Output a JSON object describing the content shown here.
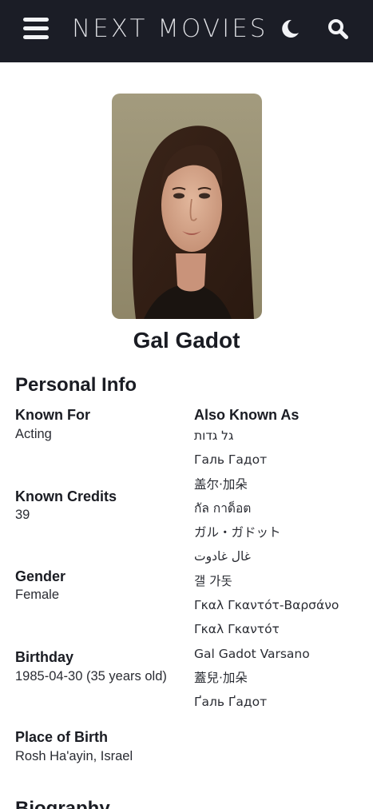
{
  "header": {
    "brand": "NEXT MOVIES",
    "menu_icon": "hamburger-menu-icon",
    "theme_icon": "moon-icon",
    "search_icon": "search-icon",
    "background": "#1b1d26"
  },
  "person": {
    "name": "Gal Gadot",
    "photo_alt": "Gal Gadot"
  },
  "personal_info": {
    "title": "Personal Info",
    "known_for_label": "Known For",
    "known_for": "Acting",
    "known_credits_label": "Known Credits",
    "known_credits": "39",
    "gender_label": "Gender",
    "gender": "Female",
    "birthday_label": "Birthday",
    "birthday": "1985-04-30 (35 years old)",
    "place_of_birth_label": "Place of Birth",
    "place_of_birth": "Rosh Ha'ayin, Israel"
  },
  "also_known_as": {
    "label": "Also Known As",
    "names": [
      "גל גדות",
      "Галь Гадот",
      "盖尔·加朵",
      "กัล กาด็อต",
      "ガル・ガドット",
      "غال غادوت",
      "갤 가돗",
      "Γκαλ Γκαντότ-Βαρσάνο",
      "Γκαλ Γκαντότ",
      "Gal Gadot Varsano",
      "蓋兒·加朵",
      "Ґаль Ґадот"
    ]
  },
  "biography": {
    "title": "Biography"
  }
}
